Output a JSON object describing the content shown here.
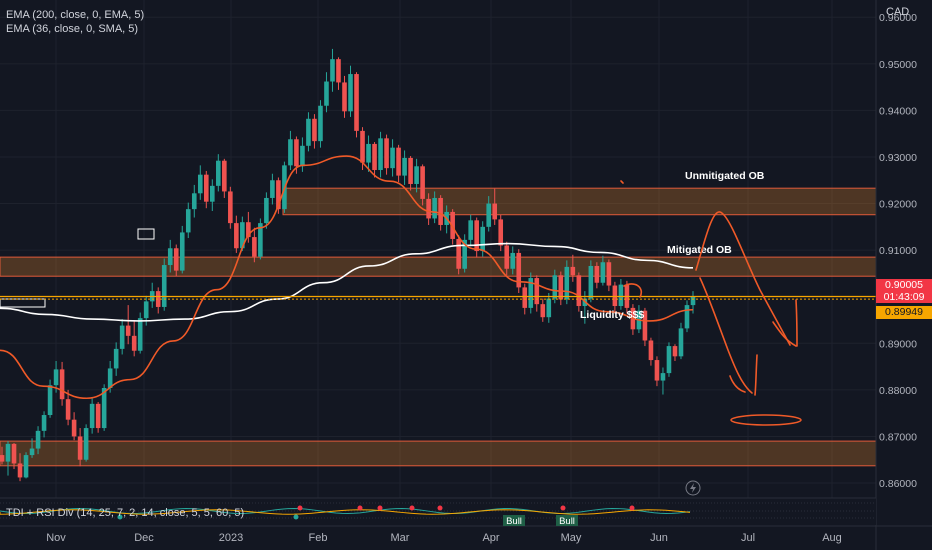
{
  "chart_data": {
    "type": "candlestick",
    "currency": "CAD",
    "indicators": [
      {
        "label": "EMA (200, close, 0, EMA, 5)",
        "color": "#ffffff"
      },
      {
        "label": "EMA (36, close, 0, SMA, 5)",
        "color": "#f05a28"
      }
    ],
    "y_ticks": [
      "0.96000",
      "0.95000",
      "0.94000",
      "0.93000",
      "0.92000",
      "0.91000",
      "0.90000",
      "0.89000",
      "0.88000",
      "0.87000",
      "0.86000"
    ],
    "ylim": [
      0.857,
      0.9637
    ],
    "x_ticks": [
      "Nov",
      "Dec",
      "2023",
      "Feb",
      "Mar",
      "Apr",
      "May",
      "Jun",
      "Jul",
      "Aug"
    ],
    "current_price": {
      "price": "0.90005",
      "countdown": "01:43:09"
    },
    "marked_price": "0.89949",
    "zones": [
      {
        "label": "Unmitigated OB",
        "top": 0.9233,
        "bottom": 0.9176
      },
      {
        "label": "Mitigated OB",
        "top": 0.9085,
        "bottom": 0.9044
      },
      {
        "label": "",
        "top": 0.869,
        "bottom": 0.8637
      }
    ],
    "annotations": [
      "Liquidity $$$"
    ],
    "candles": [
      [
        0.866,
        0.8678,
        0.864,
        0.8646
      ],
      [
        0.8646,
        0.869,
        0.8616,
        0.8684
      ],
      [
        0.8684,
        0.8686,
        0.863,
        0.8642
      ],
      [
        0.8642,
        0.8664,
        0.8604,
        0.8612
      ],
      [
        0.8612,
        0.8666,
        0.861,
        0.866
      ],
      [
        0.866,
        0.8696,
        0.8654,
        0.8674
      ],
      [
        0.8674,
        0.8722,
        0.8662,
        0.8712
      ],
      [
        0.8712,
        0.8754,
        0.8698,
        0.8746
      ],
      [
        0.8746,
        0.8822,
        0.874,
        0.881
      ],
      [
        0.881,
        0.8862,
        0.8794,
        0.8844
      ],
      [
        0.8844,
        0.886,
        0.8766,
        0.878
      ],
      [
        0.878,
        0.88,
        0.8724,
        0.8736
      ],
      [
        0.8736,
        0.8752,
        0.8692,
        0.87
      ],
      [
        0.87,
        0.8718,
        0.8636,
        0.865
      ],
      [
        0.865,
        0.8726,
        0.8646,
        0.8718
      ],
      [
        0.8718,
        0.8782,
        0.8706,
        0.877
      ],
      [
        0.877,
        0.8774,
        0.8708,
        0.8718
      ],
      [
        0.8718,
        0.8812,
        0.8712,
        0.8804
      ],
      [
        0.8804,
        0.8862,
        0.8794,
        0.8846
      ],
      [
        0.8846,
        0.8902,
        0.883,
        0.8888
      ],
      [
        0.8888,
        0.8952,
        0.8876,
        0.8938
      ],
      [
        0.8938,
        0.8982,
        0.8898,
        0.8916
      ],
      [
        0.8916,
        0.895,
        0.8872,
        0.8884
      ],
      [
        0.8884,
        0.8966,
        0.8878,
        0.8954
      ],
      [
        0.8954,
        0.9002,
        0.8938,
        0.899
      ],
      [
        0.899,
        0.903,
        0.8976,
        0.9012
      ],
      [
        0.9012,
        0.902,
        0.8964,
        0.8978
      ],
      [
        0.8978,
        0.9082,
        0.897,
        0.9068
      ],
      [
        0.9068,
        0.9122,
        0.9052,
        0.9104
      ],
      [
        0.9104,
        0.9112,
        0.9044,
        0.9056
      ],
      [
        0.9056,
        0.9152,
        0.905,
        0.9138
      ],
      [
        0.9138,
        0.9202,
        0.9126,
        0.9188
      ],
      [
        0.9188,
        0.924,
        0.917,
        0.9222
      ],
      [
        0.9222,
        0.9282,
        0.9208,
        0.9262
      ],
      [
        0.9262,
        0.927,
        0.919,
        0.9204
      ],
      [
        0.9204,
        0.9252,
        0.9184,
        0.9238
      ],
      [
        0.9238,
        0.9306,
        0.9226,
        0.9292
      ],
      [
        0.9292,
        0.9296,
        0.9212,
        0.9226
      ],
      [
        0.9226,
        0.9236,
        0.9146,
        0.9158
      ],
      [
        0.9158,
        0.9174,
        0.9094,
        0.9104
      ],
      [
        0.9104,
        0.9172,
        0.9098,
        0.916
      ],
      [
        0.916,
        0.9182,
        0.9116,
        0.9128
      ],
      [
        0.9128,
        0.9148,
        0.9074,
        0.9086
      ],
      [
        0.9086,
        0.9168,
        0.908,
        0.9158
      ],
      [
        0.9158,
        0.9224,
        0.9146,
        0.9212
      ],
      [
        0.9212,
        0.9264,
        0.9198,
        0.925
      ],
      [
        0.925,
        0.9256,
        0.9178,
        0.9188
      ],
      [
        0.9188,
        0.929,
        0.918,
        0.9282
      ],
      [
        0.9282,
        0.9356,
        0.9272,
        0.9338
      ],
      [
        0.9338,
        0.9344,
        0.9264,
        0.928
      ],
      [
        0.928,
        0.9342,
        0.9268,
        0.9324
      ],
      [
        0.9324,
        0.9396,
        0.9312,
        0.9382
      ],
      [
        0.9382,
        0.9392,
        0.9318,
        0.9334
      ],
      [
        0.9334,
        0.9422,
        0.932,
        0.941
      ],
      [
        0.941,
        0.9482,
        0.9396,
        0.9462
      ],
      [
        0.9462,
        0.9532,
        0.944,
        0.951
      ],
      [
        0.951,
        0.9514,
        0.9444,
        0.946
      ],
      [
        0.946,
        0.9474,
        0.9384,
        0.9398
      ],
      [
        0.9398,
        0.9496,
        0.9386,
        0.9478
      ],
      [
        0.9478,
        0.9482,
        0.9342,
        0.9356
      ],
      [
        0.9356,
        0.9364,
        0.9272,
        0.9288
      ],
      [
        0.9288,
        0.9346,
        0.9268,
        0.9328
      ],
      [
        0.9328,
        0.9332,
        0.9256,
        0.9272
      ],
      [
        0.9272,
        0.9354,
        0.9256,
        0.934
      ],
      [
        0.934,
        0.9348,
        0.9262,
        0.9276
      ],
      [
        0.9276,
        0.9338,
        0.9258,
        0.932
      ],
      [
        0.932,
        0.9326,
        0.9246,
        0.926
      ],
      [
        0.926,
        0.9314,
        0.924,
        0.9298
      ],
      [
        0.9298,
        0.9302,
        0.9228,
        0.9242
      ],
      [
        0.9242,
        0.9296,
        0.9224,
        0.928
      ],
      [
        0.928,
        0.9284,
        0.9196,
        0.921
      ],
      [
        0.921,
        0.9222,
        0.9154,
        0.9168
      ],
      [
        0.9168,
        0.9226,
        0.9158,
        0.9212
      ],
      [
        0.9212,
        0.9218,
        0.9142,
        0.9154
      ],
      [
        0.9154,
        0.9196,
        0.9136,
        0.9182
      ],
      [
        0.9182,
        0.9188,
        0.9112,
        0.9124
      ],
      [
        0.9124,
        0.9132,
        0.9048,
        0.906
      ],
      [
        0.906,
        0.9134,
        0.9052,
        0.9122
      ],
      [
        0.9122,
        0.9176,
        0.9108,
        0.9164
      ],
      [
        0.9164,
        0.917,
        0.9084,
        0.9098
      ],
      [
        0.9098,
        0.9162,
        0.9086,
        0.915
      ],
      [
        0.915,
        0.9216,
        0.914,
        0.92
      ],
      [
        0.92,
        0.9232,
        0.9154,
        0.9166
      ],
      [
        0.9166,
        0.9176,
        0.9098,
        0.911
      ],
      [
        0.911,
        0.9118,
        0.9046,
        0.906
      ],
      [
        0.906,
        0.9108,
        0.9048,
        0.9094
      ],
      [
        0.9094,
        0.9102,
        0.9008,
        0.902
      ],
      [
        0.902,
        0.9028,
        0.8962,
        0.8976
      ],
      [
        0.8976,
        0.9052,
        0.8964,
        0.904
      ],
      [
        0.904,
        0.9046,
        0.8968,
        0.8984
      ],
      [
        0.8984,
        0.8996,
        0.8946,
        0.8956
      ],
      [
        0.8956,
        0.9008,
        0.8944,
        0.8996
      ],
      [
        0.8996,
        0.9058,
        0.8986,
        0.9046
      ],
      [
        0.9046,
        0.9054,
        0.8982,
        0.8994
      ],
      [
        0.8994,
        0.9078,
        0.8984,
        0.9064
      ],
      [
        0.9064,
        0.909,
        0.9032,
        0.9046
      ],
      [
        0.9046,
        0.9052,
        0.8968,
        0.898
      ],
      [
        0.898,
        0.9012,
        0.8942,
        0.8996
      ],
      [
        0.8996,
        0.9078,
        0.8988,
        0.9066
      ],
      [
        0.9066,
        0.9074,
        0.9018,
        0.903
      ],
      [
        0.903,
        0.9088,
        0.9024,
        0.9074
      ],
      [
        0.9074,
        0.908,
        0.9012,
        0.9024
      ],
      [
        0.9024,
        0.9032,
        0.8968,
        0.898
      ],
      [
        0.898,
        0.9038,
        0.8972,
        0.9026
      ],
      [
        0.9026,
        0.9034,
        0.8964,
        0.8976
      ],
      [
        0.8976,
        0.8984,
        0.8918,
        0.893
      ],
      [
        0.893,
        0.8982,
        0.8922,
        0.897
      ],
      [
        0.897,
        0.8976,
        0.8894,
        0.8906
      ],
      [
        0.8906,
        0.8912,
        0.8852,
        0.8864
      ],
      [
        0.8864,
        0.8872,
        0.8808,
        0.882
      ],
      [
        0.882,
        0.8848,
        0.879,
        0.8836
      ],
      [
        0.8836,
        0.8902,
        0.8828,
        0.8894
      ],
      [
        0.8894,
        0.8898,
        0.8862,
        0.8872
      ],
      [
        0.8872,
        0.8944,
        0.8866,
        0.8932
      ],
      [
        0.8932,
        0.8992,
        0.8924,
        0.8982
      ],
      [
        0.8982,
        0.9012,
        0.8964,
        0.9
      ]
    ],
    "ema200": [
      0.8975,
      0.8962,
      0.8952,
      0.8948,
      0.8952,
      0.8968,
      0.8995,
      0.903,
      0.9066,
      0.9092,
      0.911,
      0.9114,
      0.9108,
      0.9095,
      0.9078,
      0.9062
    ],
    "ema36": [
      0.8885,
      0.8808,
      0.8782,
      0.8822,
      0.8905,
      0.9015,
      0.9148,
      0.9282,
      0.9302,
      0.9248,
      0.9182,
      0.9102,
      0.9032,
      0.9012,
      0.8968,
      0.8948,
      0.8972
    ],
    "tdi_label": "TDI + RSI Div (14, 25, 7, 2, 14, close, 5, 5, 60, 5)",
    "bull_labels": [
      "Bull",
      "Bull"
    ],
    "x_axis_top_label": "2023"
  }
}
